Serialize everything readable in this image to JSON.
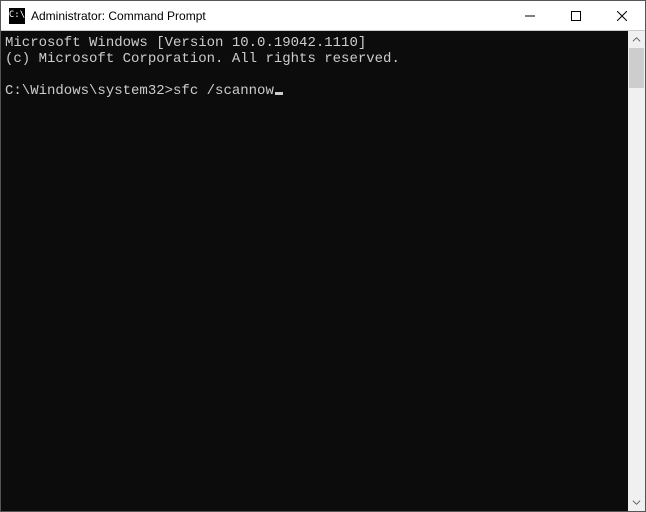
{
  "window": {
    "title": "Administrator: Command Prompt",
    "icon_label": "C:\\"
  },
  "console": {
    "line1": "Microsoft Windows [Version 10.0.19042.1110]",
    "line2": "(c) Microsoft Corporation. All rights reserved.",
    "blank": "",
    "prompt": "C:\\Windows\\system32>",
    "command": "sfc /scannow"
  }
}
